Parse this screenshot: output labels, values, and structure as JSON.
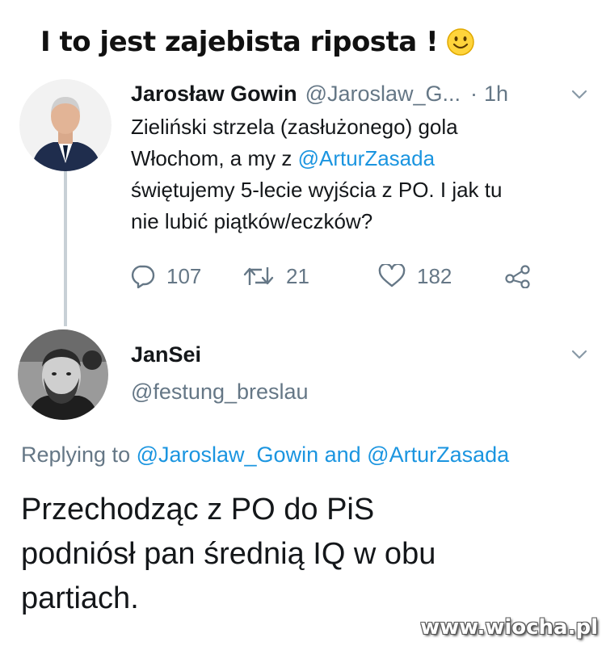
{
  "headline": {
    "text": "I to jest zajebista riposta !",
    "emoji_icon": "smiley-face-icon"
  },
  "tweet": {
    "author_name": "Jarosław Gowin",
    "author_handle": "@Jaroslaw_G...",
    "separator": "·",
    "time": "1h",
    "body": {
      "line1": "Zieliński strzela (zasłużonego) gola",
      "line2_prefix": "Włochom, a my z ",
      "line2_mention": "@ArturZasada",
      "line3": "świętujemy 5-lecie wyjścia z PO. I jak tu",
      "line4": "nie lubić piątków/eczków?"
    },
    "actions": {
      "replies": "107",
      "retweets": "21",
      "likes": "182"
    }
  },
  "reply": {
    "author_name": "JanSei",
    "author_handle": "@festung_breslau",
    "replying_to": {
      "prefix": "Replying to ",
      "mention1": "@Jaroslaw_Gowin",
      "conjunction": " and ",
      "mention2": "@ArturZasada"
    },
    "body": {
      "line1": "Przechodząc z PO do PiS",
      "line2": "podniósł pan średnią IQ w obu",
      "line3": "partiach."
    }
  },
  "watermark": "www.wiocha.pl",
  "colors": {
    "mention": "#1b95e0",
    "secondary_text": "#657786",
    "primary_text": "#14171a",
    "thread_line": "#c8d0d6"
  }
}
